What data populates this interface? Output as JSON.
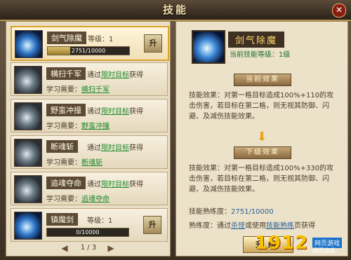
{
  "window": {
    "title": "技能",
    "close_glyph": "✕"
  },
  "skills": [
    {
      "name": "剑气除魔",
      "level_label": "等级：1",
      "progress_text": "2751/10000",
      "progress_value": 0.275,
      "upgrade_label": "升"
    },
    {
      "name": "横扫千军",
      "obtain_prefix": "通过",
      "obtain_link": "限时目标",
      "obtain_suffix": "获得",
      "learn_label": "学习需要：",
      "learn_value": "横扫千军"
    },
    {
      "name": "野蛮冲撞",
      "obtain_prefix": "通过",
      "obtain_link": "限时目标",
      "obtain_suffix": "获得",
      "learn_label": "学习需要：",
      "learn_value": "野蛮冲撞"
    },
    {
      "name": "断魂斩",
      "obtain_prefix": "通过",
      "obtain_link": "限时目标",
      "obtain_suffix": "获得",
      "learn_label": "学习需要：",
      "learn_value": "断魂斩"
    },
    {
      "name": "追魂夺命",
      "obtain_prefix": "通过",
      "obtain_link": "限时目标",
      "obtain_suffix": "获得",
      "learn_label": "学习需要：",
      "learn_value": "追魂夺命"
    },
    {
      "name": "镇魔剑",
      "level_label": "等级：1",
      "progress_text": "0/10000",
      "progress_value": 0.0,
      "upgrade_label": "升"
    }
  ],
  "pager": {
    "text": "1 / 3",
    "prev_glyph": "◀",
    "next_glyph": "▶"
  },
  "detail": {
    "name": "剑气除魔",
    "current_level": "当前技能等级：1级",
    "current_title": "当前效果",
    "current_text": "技能效果：对第一格目标造成100%+110的攻击伤害，若目标在第二格，则无视其防御、闪避、及减伤技能效果。",
    "down_glyph": "⬇",
    "next_title": "下级效果",
    "next_text": "技能效果：对第一格目标造成100%+330的攻击伤害，若目标在第二格，则无视其防御、闪避、及减伤技能效果。",
    "prof_label": "技能熟练度：",
    "prof_value": "2751/10000",
    "hint_prefix": "熟练度：通过",
    "hint_link1": "杀怪",
    "hint_mid": "或使用",
    "hint_link2": "技能熟练",
    "hint_suffix": "页获得",
    "upgrade_label": "升级"
  },
  "watermark": {
    "number": "1912",
    "tag1": "网页游戏",
    "tag2": "网页游戏"
  }
}
